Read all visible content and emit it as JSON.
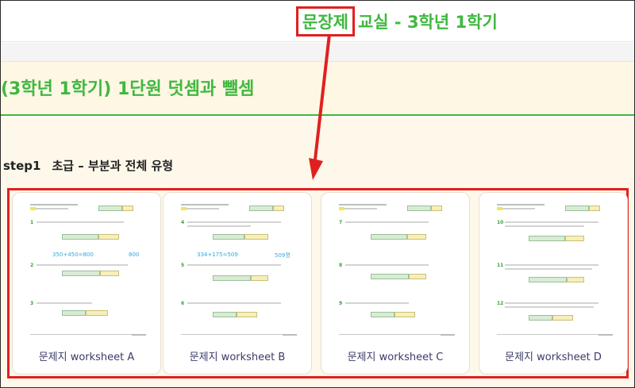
{
  "header": {
    "highlight": "문장제",
    "title_rest": "교실 - 3학년 1학기"
  },
  "unit": {
    "title": "(3학년 1학기) 1단원 덧셈과 뺄셈"
  },
  "section": {
    "step": "step1",
    "level": "초급",
    "dash": "–",
    "type": "부분과 전체 유형"
  },
  "worksheets": [
    {
      "label": "문제지 worksheet A",
      "numbers": [
        "1",
        "2",
        "3"
      ],
      "equation": "350+450=800",
      "answer": "800"
    },
    {
      "label": "문제지 worksheet B",
      "numbers": [
        "4",
        "5",
        "6"
      ],
      "equation": "334+175=509",
      "answer": "509명"
    },
    {
      "label": "문제지 worksheet C",
      "numbers": [
        "7",
        "8",
        "9"
      ],
      "equation": "",
      "answer": ""
    },
    {
      "label": "문제지 worksheet D",
      "numbers": [
        "10",
        "11",
        "12"
      ],
      "equation": "",
      "answer": ""
    }
  ],
  "colors": {
    "accent_green": "#3fb83f",
    "highlight_red": "#e02020",
    "banner_bg": "#fdf7e4"
  }
}
